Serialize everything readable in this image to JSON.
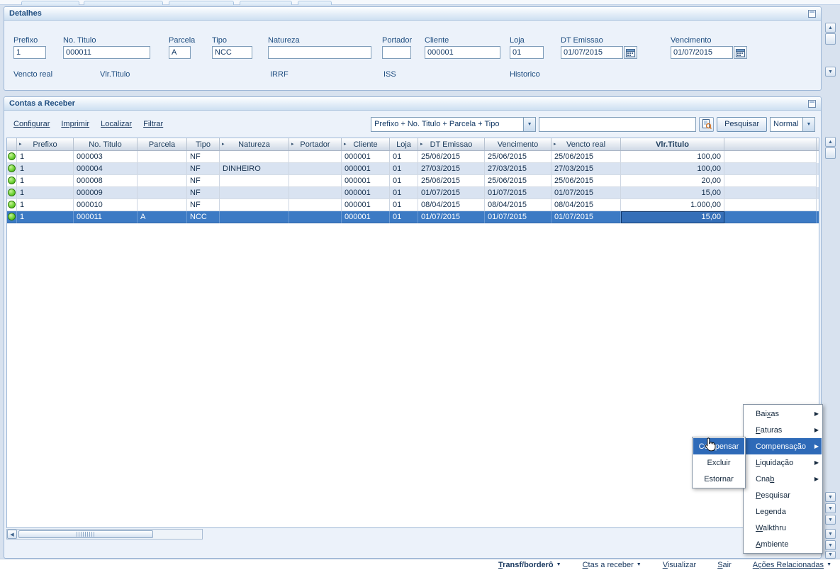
{
  "icons": {
    "dropdown_arrow": "▼",
    "scroll_up": "▲",
    "scroll_down": "▼",
    "scroll_left": "◀",
    "submenu_arrow": "▶",
    "header_arrow": "▸"
  },
  "detalhes": {
    "title": "Detalhes",
    "fields": [
      {
        "label": "Prefixo",
        "value": "1"
      },
      {
        "label": "No. Titulo",
        "value": "000011"
      },
      {
        "label": "Parcela",
        "value": "A"
      },
      {
        "label": "Tipo",
        "value": "NCC"
      },
      {
        "label": "Natureza",
        "value": ""
      },
      {
        "label": "Portador",
        "value": ""
      },
      {
        "label": "Cliente",
        "value": "000001"
      },
      {
        "label": "Loja",
        "value": "01"
      },
      {
        "label": "DT Emissao",
        "value": "01/07/2015"
      },
      {
        "label": "Vencimento",
        "value": "01/07/2015"
      }
    ],
    "extra_labels": [
      "Vencto real",
      "Vlr.Titulo",
      "IRRF",
      "ISS",
      "Historico"
    ]
  },
  "browse": {
    "title": "Contas a Receber",
    "links": [
      "Configurar",
      "Imprimir",
      "Localizar",
      "Filtrar"
    ],
    "order_combo": "Prefixo + No. Titulo + Parcela + Tipo",
    "search_value": "",
    "search_button": "Pesquisar",
    "view_combo": "Normal"
  },
  "grid": {
    "columns": [
      {
        "label": "",
        "arrow": false
      },
      {
        "label": "Prefixo",
        "arrow": true
      },
      {
        "label": "No. Titulo",
        "arrow": false
      },
      {
        "label": "Parcela",
        "arrow": false
      },
      {
        "label": "Tipo",
        "arrow": false
      },
      {
        "label": "Natureza",
        "arrow": true
      },
      {
        "label": "Portador",
        "arrow": true
      },
      {
        "label": "Cliente",
        "arrow": true
      },
      {
        "label": "Loja",
        "arrow": false
      },
      {
        "label": "DT Emissao",
        "arrow": true
      },
      {
        "label": "Vencimento",
        "arrow": false
      },
      {
        "label": "Vencto real",
        "arrow": true
      },
      {
        "label": "Vlr.Titulo",
        "arrow": false,
        "bold": true
      }
    ],
    "rows": [
      {
        "selected": false,
        "cells": [
          "1",
          "000003",
          "",
          "NF",
          "",
          "",
          "000001",
          "01",
          "25/06/2015",
          "25/06/2015",
          "25/06/2015",
          "100,00"
        ]
      },
      {
        "selected": false,
        "cells": [
          "1",
          "000004",
          "",
          "NF",
          "DINHEIRO",
          "",
          "000001",
          "01",
          "27/03/2015",
          "27/03/2015",
          "27/03/2015",
          "100,00"
        ]
      },
      {
        "selected": false,
        "cells": [
          "1",
          "000008",
          "",
          "NF",
          "",
          "",
          "000001",
          "01",
          "25/06/2015",
          "25/06/2015",
          "25/06/2015",
          "20,00"
        ]
      },
      {
        "selected": false,
        "cells": [
          "1",
          "000009",
          "",
          "NF",
          "",
          "",
          "000001",
          "01",
          "01/07/2015",
          "01/07/2015",
          "01/07/2015",
          "15,00"
        ]
      },
      {
        "selected": false,
        "cells": [
          "1",
          "000010",
          "",
          "NF",
          "",
          "",
          "000001",
          "01",
          "08/04/2015",
          "08/04/2015",
          "08/04/2015",
          "1.000,00"
        ]
      },
      {
        "selected": true,
        "cells": [
          "1",
          "000011",
          "A",
          "NCC",
          "",
          "",
          "000001",
          "01",
          "01/07/2015",
          "01/07/2015",
          "01/07/2015",
          "15,00"
        ]
      }
    ]
  },
  "context_menu": {
    "items": [
      {
        "label": "Baixas",
        "accel": "x",
        "submenu": true,
        "highlighted": false
      },
      {
        "label": "Faturas",
        "accel": "F",
        "submenu": true,
        "highlighted": false
      },
      {
        "label": "Compensação",
        "accel": null,
        "submenu": true,
        "highlighted": true
      },
      {
        "label": "Liquidação",
        "accel": "L",
        "submenu": true,
        "highlighted": false
      },
      {
        "label": "Cnab",
        "accel": "b",
        "submenu": true,
        "highlighted": false
      },
      {
        "label": "Pesquisar",
        "accel": "P",
        "submenu": false,
        "highlighted": false
      },
      {
        "label": "Legenda",
        "accel": null,
        "submenu": false,
        "highlighted": false
      },
      {
        "label": "Walkthru",
        "accel": "W",
        "submenu": false,
        "highlighted": false
      },
      {
        "label": "Ambiente",
        "accel": "A",
        "submenu": false,
        "highlighted": false
      }
    ]
  },
  "submenu": {
    "items": [
      {
        "label": "Compensar",
        "highlighted": true
      },
      {
        "label": "Excluir",
        "highlighted": false
      },
      {
        "label": "Estornar",
        "highlighted": false
      }
    ]
  },
  "bottom_bar": {
    "items": [
      {
        "label": "Transf/borderô",
        "accel": "T",
        "caret": true,
        "bold": true,
        "underline_all": false
      },
      {
        "label": "Ctas a receber",
        "accel": "C",
        "caret": true,
        "bold": false,
        "underline_all": false
      },
      {
        "label": "Visualizar",
        "accel": "V",
        "caret": false,
        "bold": false,
        "underline_all": false
      },
      {
        "label": "Sair",
        "accel": "S",
        "caret": false,
        "bold": false,
        "underline_all": false
      },
      {
        "label": "Ações Relacionadas",
        "accel": null,
        "caret": true,
        "bold": false,
        "underline_all": true
      }
    ]
  },
  "colors": {
    "selection": "#3c7ac4",
    "menu_highlight": "#2e6ab8",
    "status_green": "#5cc425",
    "panel_header_text": "#1d4c7f"
  }
}
